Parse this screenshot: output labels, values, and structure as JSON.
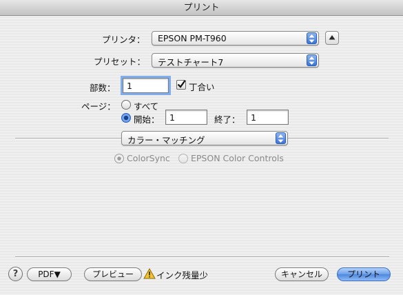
{
  "window": {
    "title": "プリント"
  },
  "printer": {
    "label": "プリンタ：",
    "value": "EPSON PM-T960"
  },
  "preset": {
    "label": "プリセット：",
    "value": "テストチャート7"
  },
  "copies": {
    "label": "部数：",
    "value": "1",
    "collate_label": "丁合い",
    "collate_checked": true
  },
  "pages": {
    "label": "ページ：",
    "all_label": "すべて",
    "from_label": "開始：",
    "from_value": "1",
    "to_label": "終了：",
    "to_value": "1",
    "selected": "range"
  },
  "panel": {
    "value": "カラー・マッチング"
  },
  "color": {
    "option1": "ColorSync",
    "option2": "EPSON Color Controls",
    "selected": "ColorSync"
  },
  "footer": {
    "help_label": "?",
    "pdf_label": "PDF▼",
    "preview_label": "プレビュー",
    "warning_text": "インク残量少",
    "cancel_label": "キャンセル",
    "print_label": "プリント"
  },
  "colors": {
    "accent": "#3a73d8",
    "warning": "#f2c230"
  },
  "icons": {
    "popup": "up-down-arrows-icon",
    "expand": "up-triangle-icon",
    "warning": "warning-triangle-icon",
    "check": "checkmark-icon"
  }
}
